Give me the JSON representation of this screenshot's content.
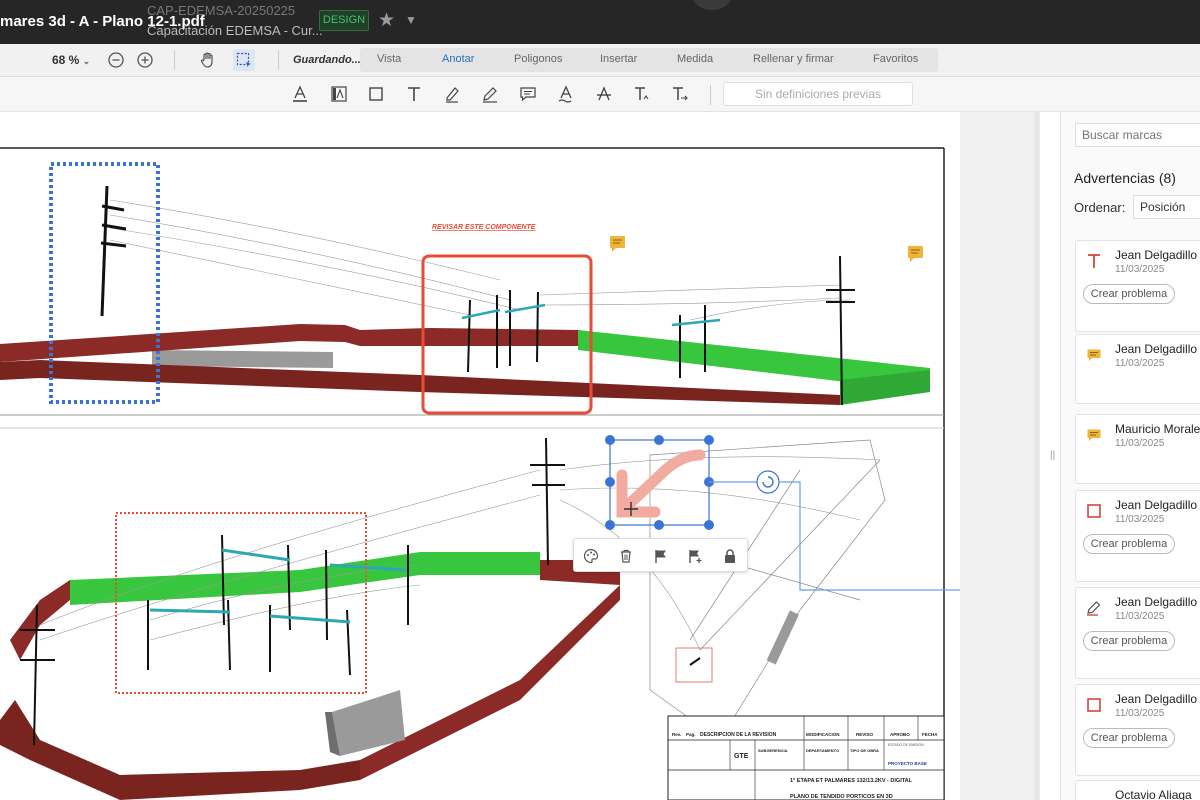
{
  "window": {
    "file_title": "mares 3d - A - Plano 12-1.pdf",
    "project_code": "CAP-EDEMSA-20250225",
    "project_name": "Capacitación EDEMSA - Cur...",
    "badge": "DESIGN"
  },
  "toolbar": {
    "zoom": "68 %",
    "saving": "Guardando...",
    "tabs": [
      {
        "label": "Vista"
      },
      {
        "label": "Anotar"
      },
      {
        "label": "Poligonos"
      },
      {
        "label": "Insertar"
      },
      {
        "label": "Medida"
      },
      {
        "label": "Rellenar y firmar"
      },
      {
        "label": "Favoritos"
      }
    ],
    "active_tab": "Anotar",
    "presets_placeholder": "Sin definiciones previas"
  },
  "drawing": {
    "annotation_note": "REVISAR ESTE COMPONENTE",
    "title_block": {
      "rev": "Rev.",
      "pag": "Pag.",
      "desc": "DESCRIPCION DE LA REVISION",
      "mod": "MODIFICACION",
      "reviso": "REVISO",
      "aprobo": "APROBO",
      "fecha": "FECHA",
      "gte": "GTE",
      "subgerencia": "SUBGERENCIA",
      "departamento": "DEPARTAMENTO",
      "tipo_obra": "TIPO DE OBRA",
      "estado": "ESTADO DE EMISION",
      "proyecto_base": "PROYECTO BASE",
      "project_line": "1° ETAPA ET PALMARES 132/13.2KV - DIGITAL",
      "plan_line": "PLANO DE TENDIDO PORTICOS EN 3D"
    }
  },
  "panel": {
    "search_placeholder": "Buscar marcas",
    "title": "Advertencias",
    "count": "(8)",
    "sort_label": "Ordenar:",
    "sort_value": "Posición",
    "items": [
      {
        "name": "Jean Delgadillo",
        "date": "11/03/2025",
        "icon": "text-icon",
        "button": "Crear problema"
      },
      {
        "name": "Jean Delgadillo",
        "date": "11/03/2025",
        "icon": "comment-icon",
        "button": ""
      },
      {
        "name": "Mauricio Morale",
        "date": "11/03/2025",
        "icon": "comment-icon",
        "button": ""
      },
      {
        "name": "Jean Delgadillo",
        "date": "11/03/2025",
        "icon": "rectangle-icon",
        "button": "Crear problema"
      },
      {
        "name": "Jean Delgadillo",
        "date": "11/03/2025",
        "icon": "pen-icon",
        "button": "Crear problema"
      },
      {
        "name": "Jean Delgadillo",
        "date": "11/03/2025",
        "icon": "rectangle-icon",
        "button": "Crear problema"
      },
      {
        "name": "Octavio Aliaga",
        "date": "",
        "icon": "",
        "button": ""
      }
    ]
  },
  "colors": {
    "accent": "#2c6fbf",
    "titlebar": "#262626",
    "wall": "#8b2a26",
    "green": "#37c63e",
    "markup_red": "#e84b36",
    "markup_blue": "#3b73d6",
    "comment": "#f0b43c"
  }
}
